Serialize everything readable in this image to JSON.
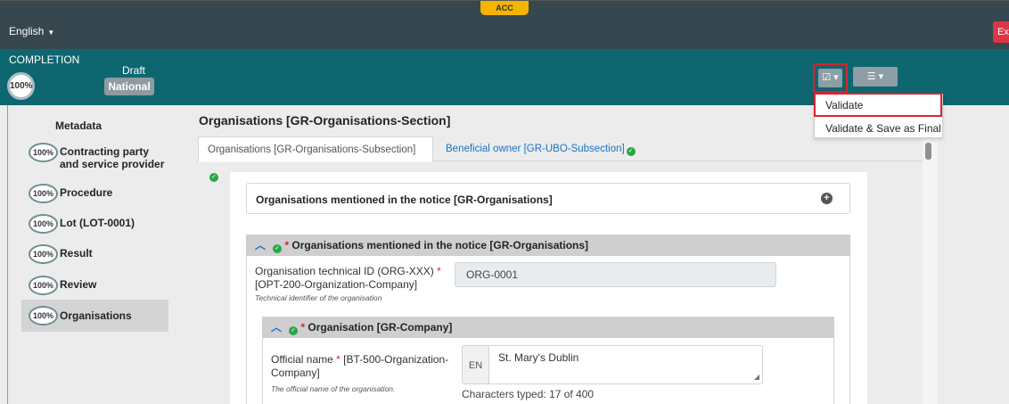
{
  "topbar": {
    "language": "English",
    "env_badge": "ACC",
    "exit_label": "Exit"
  },
  "status": {
    "completion_label": "COMPLETION",
    "completion_percent": "100%",
    "draft_label": "Draft",
    "national_label": "National"
  },
  "sidebar": {
    "title": "Metadata",
    "items": [
      {
        "percent": "100%",
        "label": "Contracting party and service provider"
      },
      {
        "percent": "100%",
        "label": "Procedure"
      },
      {
        "percent": "100%",
        "label": "Lot (LOT-0001)"
      },
      {
        "percent": "100%",
        "label": "Result"
      },
      {
        "percent": "100%",
        "label": "Review"
      },
      {
        "percent": "100%",
        "label": "Organisations"
      }
    ]
  },
  "main": {
    "section_title": "Organisations [GR-Organisations-Section]",
    "tabs": [
      {
        "label": "Organisations  [GR-Organisations-Subsection]"
      },
      {
        "label": "Beneficial owner  [GR-UBO-Subsection]"
      }
    ],
    "collapsed_group": "Organisations mentioned in the notice  [GR-Organisations]",
    "expanded_group": "Organisations mentioned in the notice  [GR-Organisations]",
    "technical_id": {
      "label_line1": "Organisation technical ID (ORG-XXX)",
      "label_line2": "[OPT-200-Organization-Company]",
      "help": "Technical identifier of the organisation",
      "value": "ORG-0001"
    },
    "company_group": "Organisation  [GR-Company]",
    "official_name": {
      "label_part1": "Official name",
      "label_part2": "[BT-500-Organization-",
      "label_line2": "Company]",
      "help": "The official name of the organisation.",
      "lang": "EN",
      "value": "St. Mary's Dublin",
      "char_count": "Characters typed: 17 of 400"
    }
  },
  "menu": {
    "validate": "Validate",
    "validate_final": "Validate & Save as Final"
  },
  "icons": {
    "validate": "check-square-icon",
    "options": "sliders-icon"
  },
  "colors": {
    "topbar": "#37474f",
    "statusbar": "#0e6670",
    "highlight": "#d9232d",
    "link": "#1a73c8",
    "ok": "#28a745"
  }
}
